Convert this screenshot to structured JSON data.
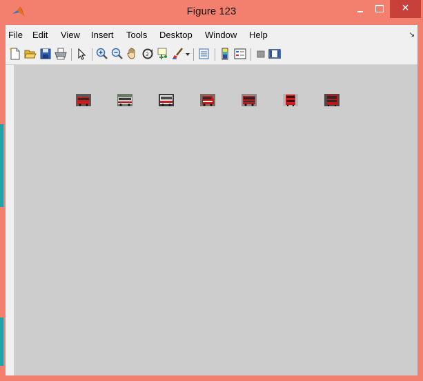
{
  "window": {
    "title": "Figure 123",
    "close_glyph": "✕",
    "app_icon": "matlab-icon"
  },
  "menu": {
    "items": [
      "File",
      "Edit",
      "View",
      "Insert",
      "Tools",
      "Desktop",
      "Window",
      "Help"
    ],
    "overflow_glyph": "↘"
  },
  "toolbar": {
    "icons": [
      "new-figure-icon",
      "open-file-icon",
      "save-figure-icon",
      "print-figure-icon",
      "edit-plot-arrow-icon",
      "zoom-in-icon",
      "zoom-out-icon",
      "pan-hand-icon",
      "rotate-3d-icon",
      "data-cursor-icon",
      "brush-icon",
      "brush-dropdown-icon",
      "link-plot-icon",
      "insert-colorbar-icon",
      "insert-legend-icon",
      "hide-plot-tools-icon",
      "show-plot-tools-icon"
    ]
  },
  "figure": {
    "thumbnails": [
      "bus-image-1",
      "bus-image-2",
      "bus-image-3",
      "bus-image-4",
      "bus-image-5",
      "bus-image-6",
      "bus-image-7"
    ]
  },
  "colors": {
    "title_bar": "#f37f6f",
    "close_button": "#c7403a",
    "canvas": "#cdcdcd",
    "chrome": "#f0f0f0"
  }
}
